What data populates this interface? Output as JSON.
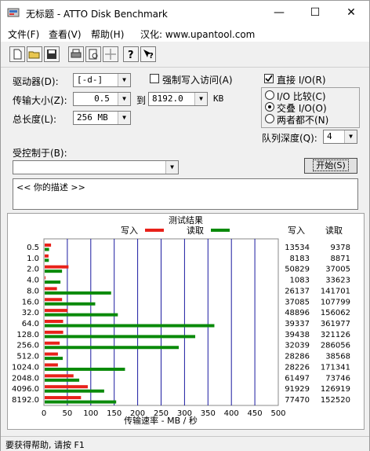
{
  "window": {
    "title": "无标题 - ATTO Disk Benchmark",
    "minimize": "—",
    "maximize": "☐",
    "close": "✕"
  },
  "menu": {
    "file": "文件(F)",
    "view": "查看(V)",
    "help": "帮助(H)",
    "localized": "汉化: www.upantool.com"
  },
  "settings": {
    "drive_label": "驱动器(D):",
    "drive_value": "[-d-]",
    "force_write_label": "强制写入访问(A)",
    "direct_io_label": "直接 I/O(R)",
    "transfer_label": "传输大小(Z):",
    "transfer_from": "0.5",
    "to_label": "到",
    "transfer_to": "8192.0",
    "kb_label": "KB",
    "io_compare_label": "I/O 比较(C)",
    "overlapped_label": "交叠 I/O(O)",
    "neither_label": "两者都不(N)",
    "total_length_label": "总长度(L):",
    "total_length_value": "256 MB",
    "queue_depth_label": "队列深度(Q):",
    "queue_depth_value": "4",
    "controlled_by_label": "受控制于(B):",
    "controlled_by_value": "",
    "start_button": "开始(S)",
    "description_text": "<<  你的描述   >>"
  },
  "results": {
    "title": "测试结果",
    "write_legend": "写入",
    "read_legend": "读取",
    "write_col": "写入",
    "read_col": "读取",
    "xlabel": "传输速率 - MB / 秒"
  },
  "status_text": "要获得帮助, 请按 F1",
  "colors": {
    "write": "#e8211a",
    "read": "#0a8a0a"
  },
  "chart_data": {
    "type": "bar",
    "orientation": "horizontal",
    "title": "测试结果",
    "xlabel": "传输速率 - MB / 秒",
    "xlim": [
      0,
      500
    ],
    "xticks": [
      0,
      50,
      100,
      150,
      200,
      250,
      300,
      350,
      400,
      450,
      500
    ],
    "categories": [
      "0.5",
      "1.0",
      "2.0",
      "4.0",
      "8.0",
      "16.0",
      "32.0",
      "64.0",
      "128.0",
      "256.0",
      "512.0",
      "1024.0",
      "2048.0",
      "4096.0",
      "8192.0"
    ],
    "series": [
      {
        "name": "写入",
        "values": [
          13534,
          8183,
          50829,
          1083,
          26137,
          37085,
          48896,
          39337,
          39438,
          32039,
          28286,
          28226,
          61497,
          91929,
          77470
        ]
      },
      {
        "name": "读取",
        "values": [
          9378,
          8871,
          37005,
          33623,
          141701,
          107799,
          156062,
          361977,
          321126,
          286056,
          38568,
          171341,
          73746,
          126919,
          152520
        ]
      }
    ],
    "value_unit_factor": 1000
  }
}
